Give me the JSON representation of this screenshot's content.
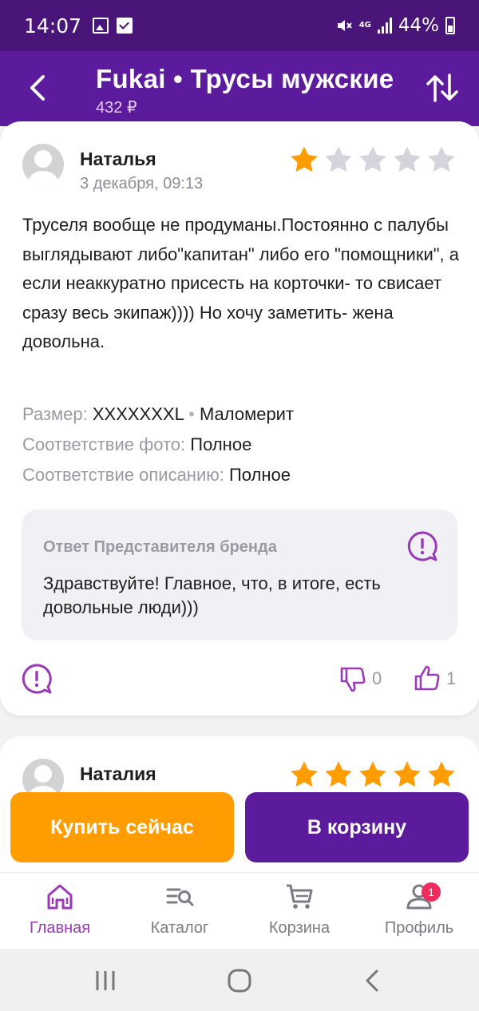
{
  "status_bar": {
    "time": "14:07",
    "network": "4G",
    "battery": "44%"
  },
  "app_bar": {
    "title": "Fukai • Трусы мужские",
    "price": "432 ₽"
  },
  "review1": {
    "author": "Наталья",
    "date": "3 декабря, 09:13",
    "rating": 1,
    "text": "Труселя вообще не продуманы.Постоянно с палубы выглядывают либо\"капитан\" либо его \"помощники\", а если неаккуратно присесть на корточки- то свисает сразу весь экипаж)))) Но хочу заметить- жена довольна.",
    "size_label": "Размер:",
    "size_value": "XXXXXXXL",
    "fit_value": "Маломерит",
    "photo_label": "Соответствие фото:",
    "photo_value": "Полное",
    "desc_label": "Соответствие описанию:",
    "desc_value": "Полное",
    "reply_title": "Ответ Представителя бренда",
    "reply_text": "Здравствуйте! Главное, что, в итоге, есть довольные люди)))",
    "dislikes": "0",
    "likes": "1"
  },
  "review2": {
    "author": "Наталия",
    "rating": 5
  },
  "actions": {
    "buy_now": "Купить сейчас",
    "add_to_cart": "В корзину"
  },
  "bottom_nav": [
    {
      "label": "Главная",
      "icon": "home-icon",
      "active": true
    },
    {
      "label": "Каталог",
      "icon": "catalog-icon"
    },
    {
      "label": "Корзина",
      "icon": "cart-icon"
    },
    {
      "label": "Профиль",
      "icon": "profile-icon",
      "badge": "1"
    }
  ],
  "colors": {
    "primary": "#5c1a9c",
    "status_bar": "#4a1578",
    "accent_orange": "#ff9c00",
    "star": "#ff9c00",
    "active_nav": "#9a3ab8"
  }
}
